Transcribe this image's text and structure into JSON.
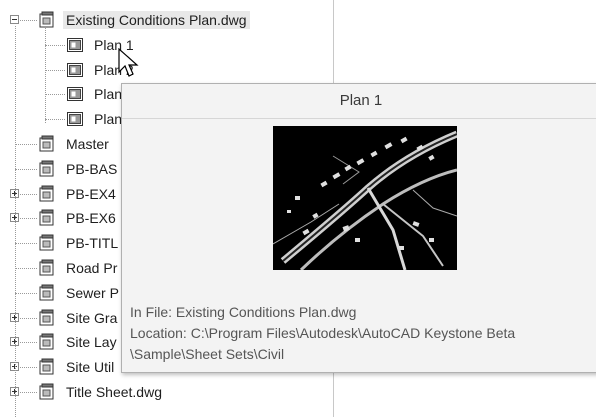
{
  "tree": {
    "nodes": [
      {
        "id": "n0",
        "label": "Existing Conditions Plan.dwg",
        "level": 0,
        "expander": "minus",
        "icon": "sheet-set-icon",
        "selected": true
      },
      {
        "id": "n1",
        "label": "Plan 1",
        "level": 1,
        "icon": "layout-icon"
      },
      {
        "id": "n2",
        "label": "Plan 2",
        "level": 1,
        "icon": "layout-icon"
      },
      {
        "id": "n3",
        "label": "Plan",
        "level": 1,
        "icon": "layout-icon"
      },
      {
        "id": "n4",
        "label": "Plan",
        "level": 1,
        "icon": "layout-icon"
      },
      {
        "id": "n5",
        "label": "Master",
        "level": 0,
        "icon": "sheet-set-icon"
      },
      {
        "id": "n6",
        "label": "PB-BAS",
        "level": 0,
        "icon": "sheet-set-icon"
      },
      {
        "id": "n7",
        "label": "PB-EX4",
        "level": 0,
        "expander": "plus",
        "icon": "sheet-set-icon"
      },
      {
        "id": "n8",
        "label": "PB-EX6",
        "level": 0,
        "expander": "plus",
        "icon": "sheet-set-icon"
      },
      {
        "id": "n9",
        "label": "PB-TITL",
        "level": 0,
        "icon": "sheet-set-icon"
      },
      {
        "id": "n10",
        "label": "Road Pr",
        "level": 0,
        "icon": "sheet-set-icon"
      },
      {
        "id": "n11",
        "label": "Sewer P",
        "level": 0,
        "icon": "sheet-set-icon"
      },
      {
        "id": "n12",
        "label": "Site Gra",
        "level": 0,
        "expander": "plus",
        "icon": "sheet-set-icon"
      },
      {
        "id": "n13",
        "label": "Site Lay",
        "level": 0,
        "expander": "plus",
        "icon": "sheet-set-icon"
      },
      {
        "id": "n14",
        "label": "Site Util",
        "level": 0,
        "expander": "plus",
        "icon": "sheet-set-icon"
      },
      {
        "id": "n15",
        "label": "Title Sheet.dwg",
        "level": 0,
        "expander": "plus",
        "icon": "sheet-set-icon"
      }
    ]
  },
  "tooltip": {
    "title": "Plan 1",
    "in_file": "In File: Existing Conditions Plan.dwg",
    "location_line1": "Location: C:\\Program Files\\Autodesk\\AutoCAD Keystone Beta",
    "location_line2": "\\Sample\\Sheet Sets\\Civil",
    "thumbnail_icon": "drawing-preview-thumbnail"
  },
  "colors": {
    "selection": "#e8e8e8",
    "tooltip_bg": "#f3f3f3",
    "thumb_bg": "#000000"
  }
}
